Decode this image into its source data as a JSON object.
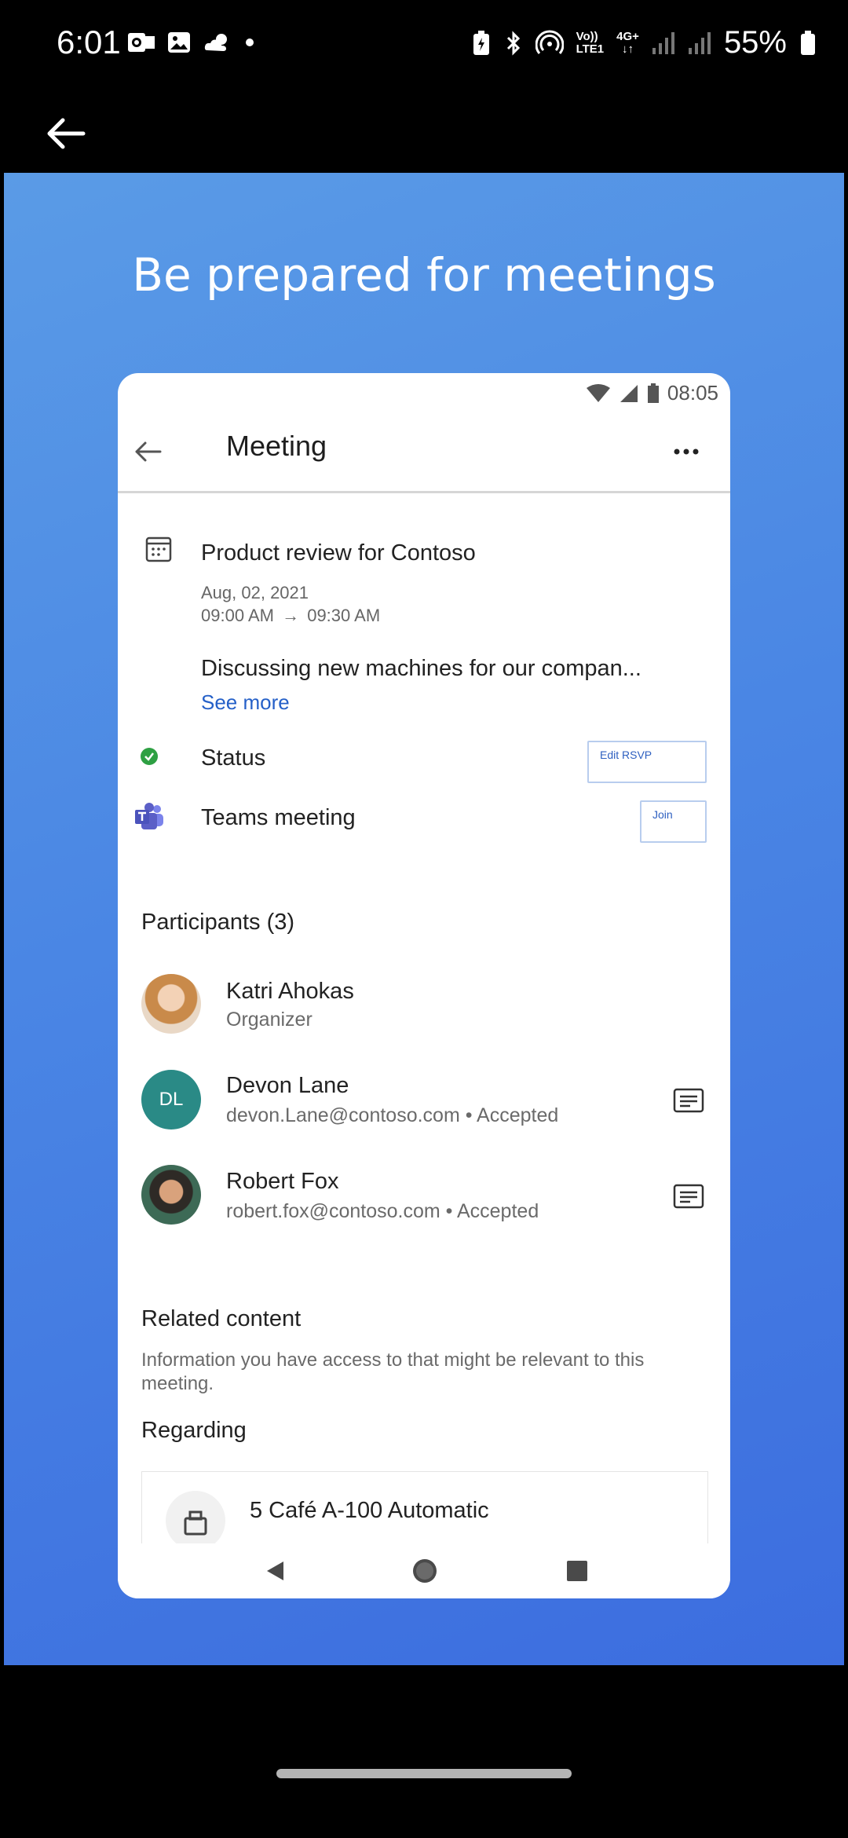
{
  "status_bar": {
    "time": "6:01",
    "network_label_top": "Vo))",
    "network_label_bottom": "LTE1",
    "data_label": "4G+",
    "battery_percent": "55%"
  },
  "promo": {
    "title": "Be prepared for meetings"
  },
  "phone": {
    "status_time": "08:05",
    "header_title": "Meeting",
    "meeting": {
      "title": "Product review for Contoso",
      "date": "Aug, 02, 2021",
      "start": "09:00 AM",
      "end": "09:30 AM",
      "description": "Discussing new machines for our compan...",
      "see_more": "See more",
      "status_label": "Status",
      "edit_rsvp": "Edit RSVP",
      "teams_label": "Teams meeting",
      "join": "Join"
    },
    "participants_header": "Participants (3)",
    "participants": [
      {
        "name": "Katri Ahokas",
        "sub": "Organizer"
      },
      {
        "name": "Devon Lane",
        "initials": "DL",
        "sub": "devon.Lane@contoso.com • Accepted"
      },
      {
        "name": "Robert Fox",
        "sub": "robert.fox@contoso.com • Accepted"
      }
    ],
    "related_header": "Related content",
    "related_desc": "Information you have access to that might be relevant to this meeting.",
    "regarding_header": "Regarding",
    "regarding_item": "5 Café A-100 Automatic"
  },
  "colors": {
    "promo_gradient_start": "#5a9be6",
    "promo_gradient_end": "#3c6ddf",
    "link_blue": "#2560c8",
    "status_green": "#2ea043",
    "teams_purple": "#5b5fc7",
    "avatar_teal": "#2a8a86"
  }
}
